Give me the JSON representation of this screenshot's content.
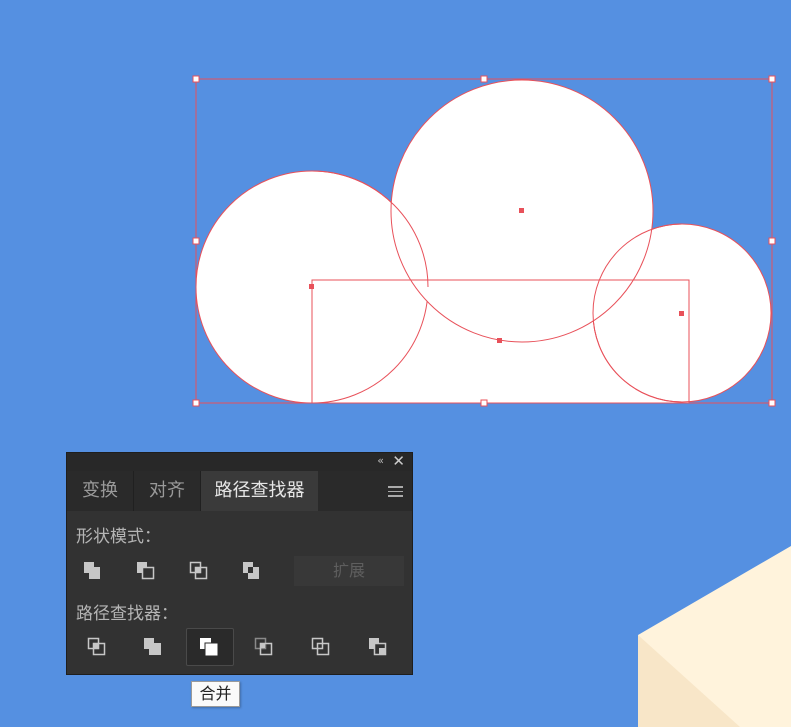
{
  "panel": {
    "tabs": [
      {
        "label": "变换",
        "active": false
      },
      {
        "label": "对齐",
        "active": false
      },
      {
        "label": "路径查找器",
        "active": true
      }
    ],
    "shape_modes_label": "形状模式：",
    "shape_modes": [
      "unite-icon",
      "minus-front-icon",
      "intersect-icon",
      "exclude-icon"
    ],
    "expand_label": "扩展",
    "pathfinders_label": "路径查找器：",
    "pathfinders": [
      "divide-icon",
      "trim-icon",
      "merge-icon",
      "crop-icon",
      "outline-icon",
      "minus-back-icon"
    ],
    "selected_pathfinder": "merge-icon"
  },
  "tooltip": "合并",
  "colors": {
    "background": "#5590E1",
    "selection": "#E8515A",
    "panel": "#323232",
    "cube_light": "#FFF3DC"
  }
}
